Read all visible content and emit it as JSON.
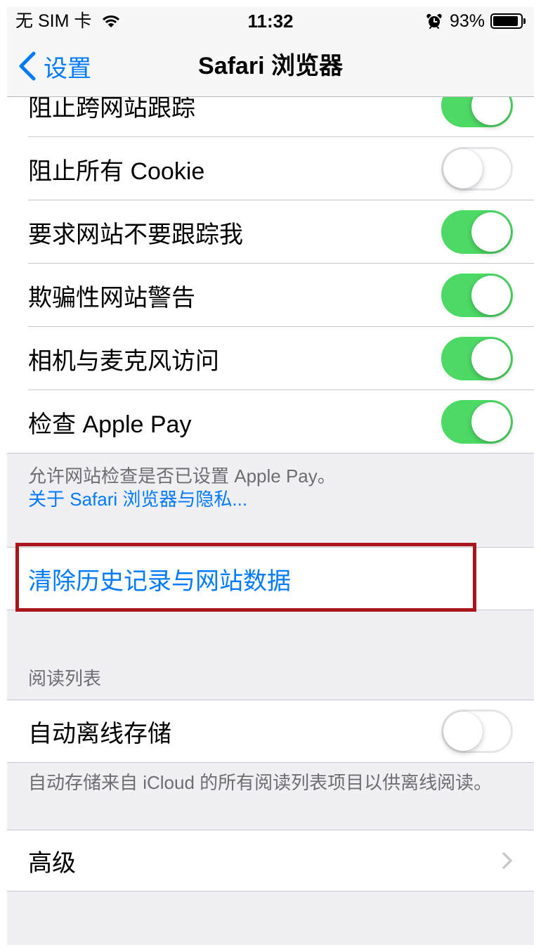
{
  "status_bar": {
    "carrier": "无 SIM 卡",
    "time": "11:32",
    "battery": {
      "label": "93%",
      "level": 0.93
    }
  },
  "nav": {
    "back_label": "设置",
    "title": "Safari 浏览器"
  },
  "privacy": {
    "rows": [
      {
        "label": "阻止跨网站跟踪",
        "on": true
      },
      {
        "label": "阻止所有 Cookie",
        "on": false
      },
      {
        "label": "要求网站不要跟踪我",
        "on": true
      },
      {
        "label": "欺骗性网站警告",
        "on": true
      },
      {
        "label": "相机与麦克风访问",
        "on": true
      },
      {
        "label": "检查 Apple Pay",
        "on": true
      }
    ],
    "footer": "允许网站检查是否已设置 Apple Pay。",
    "footer_link": "关于 Safari 浏览器与隐私..."
  },
  "clear_history": {
    "label": "清除历史记录与网站数据"
  },
  "reading_list": {
    "header": "阅读列表",
    "rows": [
      {
        "label": "自动离线存储",
        "on": false
      }
    ],
    "footer": "自动存储来自 iCloud 的所有阅读列表项目以供离线阅读。"
  },
  "advanced": {
    "label": "高级"
  },
  "icons": {
    "wifi": "wifi-icon",
    "alarm": "alarm-icon",
    "battery": "battery-icon",
    "back": "chevron-left-icon",
    "disclosure": "chevron-right-icon"
  },
  "colors": {
    "accent": "#007aff",
    "toggle_on": "#4cd964",
    "highlight_box": "#a9171c",
    "group_background": "#efeff4"
  }
}
